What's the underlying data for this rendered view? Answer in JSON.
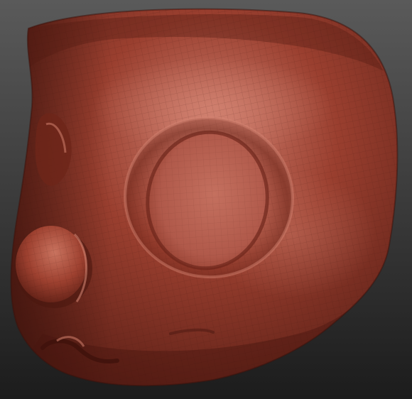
{
  "scene": {
    "subject": "sculpted-head-model",
    "background": {
      "top": "#5a5a5a",
      "bottom": "#1c1c1c"
    },
    "material": {
      "base": "#9a3f2f",
      "shadow": "#5b1f16",
      "highlight": "#d08070",
      "wire": "#3d150e"
    }
  }
}
